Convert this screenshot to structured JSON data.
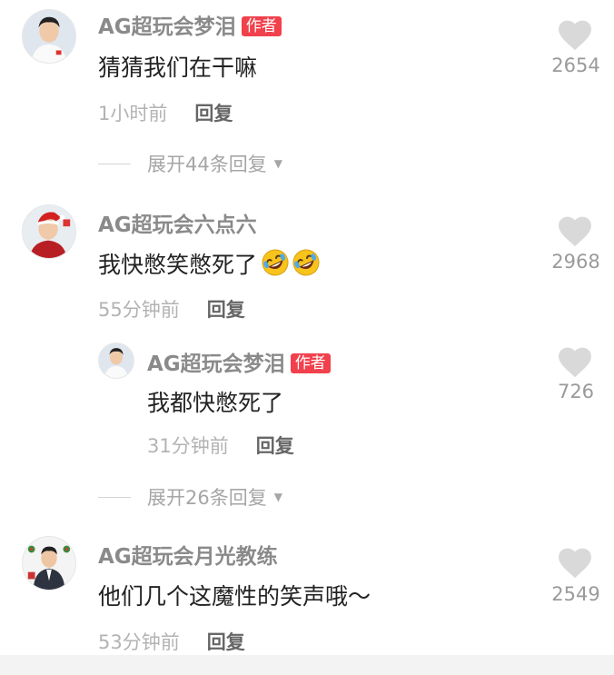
{
  "comments": [
    {
      "username": "AG超玩会梦泪",
      "badge": "作者",
      "text": "猜猜我们在干嘛",
      "time": "1小时前",
      "reply_label": "回复",
      "likes": "2654",
      "expand_label": "展开44条回复"
    },
    {
      "username": "AG超玩会六点六",
      "text": "我快憋笑憋死了",
      "time": "55分钟前",
      "reply_label": "回复",
      "likes": "2968",
      "emoji": "rofl-emoji",
      "replies": [
        {
          "username": "AG超玩会梦泪",
          "badge": "作者",
          "text": "我都快憋死了",
          "time": "31分钟前",
          "reply_label": "回复",
          "likes": "726"
        }
      ],
      "expand_label": "展开26条回复"
    },
    {
      "username": "AG超玩会月光教练",
      "text": "他们几个这魔性的笑声哦～",
      "time": "53分钟前",
      "reply_label": "回复",
      "likes": "2549"
    }
  ],
  "colors": {
    "badge": "#f1414c",
    "heart": "#d9d9d9",
    "username": "#8a8a8a"
  }
}
